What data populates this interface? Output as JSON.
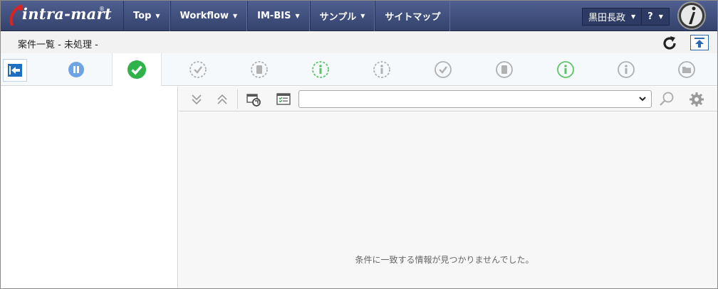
{
  "app": {
    "logo_text": "intra-mart",
    "logo_mark": "®"
  },
  "nav": [
    {
      "label": "Top",
      "has_dropdown": true
    },
    {
      "label": "Workflow",
      "has_dropdown": true
    },
    {
      "label": "IM-BIS",
      "has_dropdown": true
    },
    {
      "label": "サンプル",
      "has_dropdown": true
    },
    {
      "label": "サイトマップ",
      "has_dropdown": false
    }
  ],
  "user": {
    "name": "黒田長政",
    "help": "?"
  },
  "page": {
    "title": "案件一覧 - 未処理 -"
  },
  "status_icons": [
    {
      "name": "pause-icon",
      "color": "#6ea4e4",
      "active": false
    },
    {
      "name": "check-icon",
      "color": "#2fb24a",
      "active": true
    },
    {
      "name": "check-dashed-icon",
      "color": "#b0b0b0",
      "active": false
    },
    {
      "name": "document-dashed-icon",
      "color": "#b0b0b0",
      "active": false
    },
    {
      "name": "info-dashed-green-icon",
      "color": "#5cc36a",
      "active": false
    },
    {
      "name": "info-dashed-icon",
      "color": "#b0b0b0",
      "active": false
    },
    {
      "name": "check-circle-icon",
      "color": "#b0b0b0",
      "active": false
    },
    {
      "name": "document-circle-icon",
      "color": "#b0b0b0",
      "active": false
    },
    {
      "name": "info-green-icon",
      "color": "#5cc36a",
      "active": false
    },
    {
      "name": "info-circle-icon",
      "color": "#b0b0b0",
      "active": false
    },
    {
      "name": "folder-circle-icon",
      "color": "#b0b0b0",
      "active": false
    }
  ],
  "filter": {
    "selected": ""
  },
  "message": {
    "empty": "条件に一致する情報が見つかりませんでした。"
  },
  "colors": {
    "header": "#3f4d7a",
    "accent_blue": "#2d6ab3",
    "active_check": "#2fb24a"
  }
}
